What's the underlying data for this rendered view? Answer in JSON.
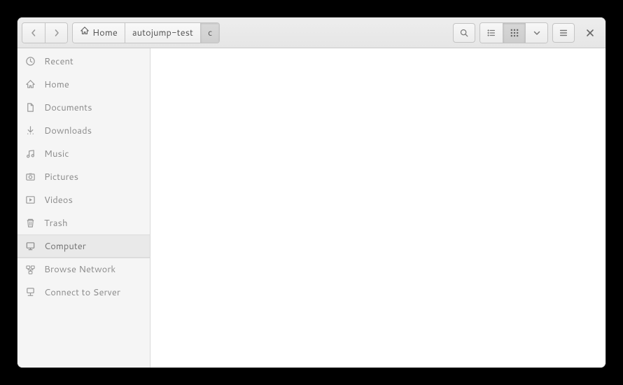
{
  "breadcrumb": {
    "home_label": "Home",
    "items": [
      "autojump-test",
      "c"
    ]
  },
  "sidebar": {
    "items": [
      {
        "icon": "clock-icon",
        "label": "Recent"
      },
      {
        "icon": "home-icon",
        "label": "Home"
      },
      {
        "icon": "documents-icon",
        "label": "Documents"
      },
      {
        "icon": "downloads-icon",
        "label": "Downloads"
      },
      {
        "icon": "music-icon",
        "label": "Music"
      },
      {
        "icon": "pictures-icon",
        "label": "Pictures"
      },
      {
        "icon": "videos-icon",
        "label": "Videos"
      },
      {
        "icon": "trash-icon",
        "label": "Trash"
      },
      {
        "icon": "computer-icon",
        "label": "Computer"
      },
      {
        "icon": "network-icon",
        "label": "Browse Network"
      },
      {
        "icon": "server-icon",
        "label": "Connect to Server"
      }
    ],
    "selected_index": 8
  }
}
